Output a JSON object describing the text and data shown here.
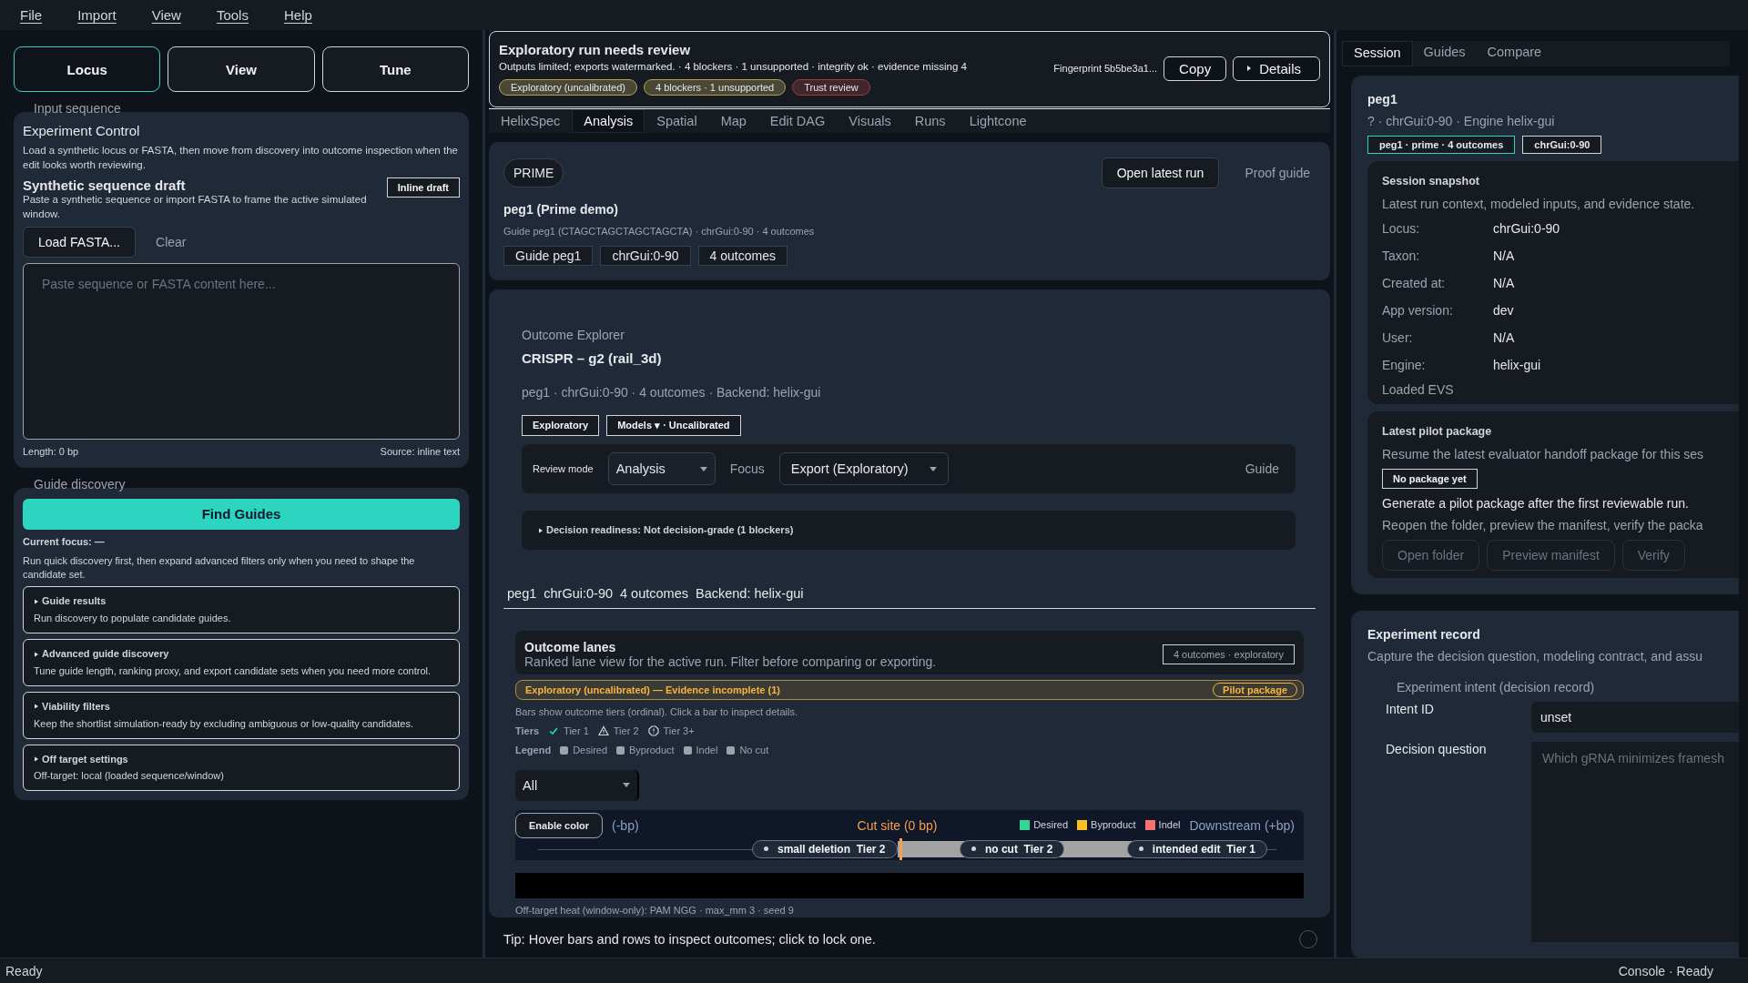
{
  "menu": [
    "File",
    "Import",
    "View",
    "Tools",
    "Help"
  ],
  "mode_tabs": [
    {
      "label": "Locus",
      "selected": true
    },
    {
      "label": "View",
      "selected": false
    },
    {
      "label": "Tune",
      "selected": false
    }
  ],
  "input_sequence": {
    "legend": "Input sequence",
    "title": "Experiment Control",
    "description": "Load a synthetic locus or FASTA, then move from discovery into outcome inspection when the edit looks worth reviewing.",
    "draft_title": "Synthetic sequence draft",
    "draft_hint": "Paste a synthetic sequence or import FASTA to frame the active simulated window.",
    "draft_badge": "Inline draft",
    "load_button": "Load FASTA...",
    "clear_button": "Clear",
    "placeholder": "Paste sequence or FASTA content here...",
    "length": "Length: 0 bp",
    "source": "Source: inline text"
  },
  "guide_discovery": {
    "legend": "Guide discovery",
    "find_button": "Find Guides",
    "current_focus": "Current focus: —",
    "hint": "Run quick discovery first, then expand advanced filters only when you need to shape the candidate set.",
    "sections": [
      {
        "title": "Guide results",
        "body": "Run discovery to populate candidate guides.",
        "expanded": false
      },
      {
        "title": "Advanced guide discovery",
        "body": "Tune guide length, ranking proxy, and export candidate sets when you need more control.",
        "expanded": false
      },
      {
        "title": "Viability filters",
        "body": "Keep the shortlist simulation-ready by excluding ambiguous or low-quality candidates.",
        "expanded": false
      },
      {
        "title": "Off target settings",
        "body": "Off-target: local (loaded sequence/window)",
        "expanded": false
      }
    ]
  },
  "review_banner": {
    "title": "Exploratory run needs review",
    "summary": "Outputs limited; exports watermarked. · 4 blockers · 1 unsupported · integrity ok · evidence missing 4",
    "badges": [
      {
        "label": "Exploratory (uncalibrated)",
        "color": "#b59f5c"
      },
      {
        "label": "4 blockers · 1 unsupported",
        "color": "#b59f5c"
      },
      {
        "label": "Trust review",
        "color": "#9b3b45"
      }
    ],
    "fingerprint": "Fingerprint 5b5be3a1...",
    "copy_button": "Copy",
    "details_button": "Details"
  },
  "center_tabs": [
    {
      "label": "HelixSpec",
      "selected": false
    },
    {
      "label": "Analysis",
      "selected": true
    },
    {
      "label": "Spatial",
      "selected": false
    },
    {
      "label": "Map",
      "selected": false
    },
    {
      "label": "Edit DAG",
      "selected": false
    },
    {
      "label": "Visuals",
      "selected": false
    },
    {
      "label": "Runs",
      "selected": false
    },
    {
      "label": "Lightcone",
      "selected": false
    }
  ],
  "prime": {
    "badge": "PRIME",
    "open_button": "Open latest run",
    "proof_link": "Proof guide",
    "title": "peg1 (Prime demo)",
    "subtitle": "Guide peg1 (CTAGCTAGCTAGCTAGCTA) · chrGui:0-90 · 4 outcomes",
    "chips": [
      "Guide peg1",
      "chrGui:0-90",
      "4 outcomes"
    ]
  },
  "explorer": {
    "kicker": "Outcome Explorer",
    "title": "CRISPR – g2 (rail_3d)",
    "meta": "peg1 · chrGui:0-90 · 4 outcomes · Backend: helix-gui",
    "tags": [
      "Exploratory",
      "Models ▾ · Uncalibrated"
    ],
    "review_mode_label": "Review mode",
    "review_mode_value": "Analysis",
    "focus_label": "Focus",
    "focus_value": "Export (Exploratory)",
    "guide_link": "Guide",
    "decision": "Decision readiness: Not decision-grade (1 blockers)",
    "summary_items": [
      "peg1",
      "chrGui:0-90",
      "4 outcomes",
      "Backend: helix-gui"
    ]
  },
  "lanes": {
    "title": "Outcome lanes",
    "subtitle": "Ranked lane view for the active run. Filter before comparing or exporting.",
    "count_badge": "4 outcomes · exploratory",
    "warning": "Exploratory (uncalibrated) — Evidence incomplete (1)",
    "pilot_button": "Pilot package",
    "hint": "Bars show outcome tiers (ordinal). Click a bar to inspect details.",
    "tiers_label": "Tiers",
    "tiers": [
      {
        "label": "Tier 1",
        "kind": "check"
      },
      {
        "label": "Tier 2",
        "kind": "warning"
      },
      {
        "label": "Tier 3+",
        "kind": "alert"
      }
    ],
    "legend_label": "Legend",
    "legend": [
      "Desired",
      "Byproduct",
      "Indel",
      "No cut"
    ],
    "filter_value": "All",
    "enable_color": "Enable color",
    "upstream": "(-bp)",
    "cut_site": "Cut site (0 bp)",
    "downstream": "Downstream (+bp)",
    "key": [
      {
        "label": "Desired",
        "color": "#34d399"
      },
      {
        "label": "Byproduct",
        "color": "#fbbf24"
      },
      {
        "label": "Indel",
        "color": "#f87171"
      }
    ],
    "outcomes": [
      {
        "label": "small deletion",
        "tier": "Tier 2"
      },
      {
        "label": "no cut",
        "tier": "Tier 2"
      },
      {
        "label": "intended edit",
        "tier": "Tier 1"
      }
    ],
    "footnote": "Off-target heat (window-only): PAM NGG · max_mm 3 · seed 9"
  },
  "tip": "Tip: Hover bars and rows to inspect outcomes; click to lock one.",
  "side_tabs": [
    {
      "label": "Session",
      "selected": true
    },
    {
      "label": "Guides",
      "selected": false
    },
    {
      "label": "Compare",
      "selected": false
    }
  ],
  "session": {
    "title": "peg1",
    "meta": "? · chrGui:0-90 · Engine helix-gui",
    "chips": [
      {
        "label": "peg1 · prime · 4 outcomes",
        "selected": true
      },
      {
        "label": "chrGui:0-90",
        "selected": false
      }
    ],
    "snapshot": {
      "title": "Session snapshot",
      "description": "Latest run context, modeled inputs, and evidence state.",
      "rows": [
        {
          "label": "Locus:",
          "value": "chrGui:0-90"
        },
        {
          "label": "Taxon:",
          "value": "N/A"
        },
        {
          "label": "Created at:",
          "value": "N/A"
        },
        {
          "label": "App version:",
          "value": "dev"
        },
        {
          "label": "User:",
          "value": "N/A"
        },
        {
          "label": "Engine:",
          "value": "helix-gui"
        }
      ],
      "footer": "Loaded EVS"
    },
    "pilot": {
      "title": "Latest pilot package",
      "description": "Resume the latest evaluator handoff package for this ses",
      "badge": "No package yet",
      "note": "Generate a pilot package after the first reviewable run.",
      "hint": "Reopen the folder, preview the manifest, verify the packa",
      "buttons": [
        "Open folder",
        "Preview manifest",
        "Verify"
      ]
    }
  },
  "experiment_record": {
    "title": "Experiment record",
    "description": "Capture the decision question, modeling contract, and assu",
    "legend": "Experiment intent (decision record)",
    "intent_label": "Intent ID",
    "intent_value": "unset",
    "question_label": "Decision question",
    "question_placeholder": "Which gRNA minimizes framesh"
  },
  "status_bar": {
    "left": "Ready",
    "right": "Console · Ready"
  }
}
